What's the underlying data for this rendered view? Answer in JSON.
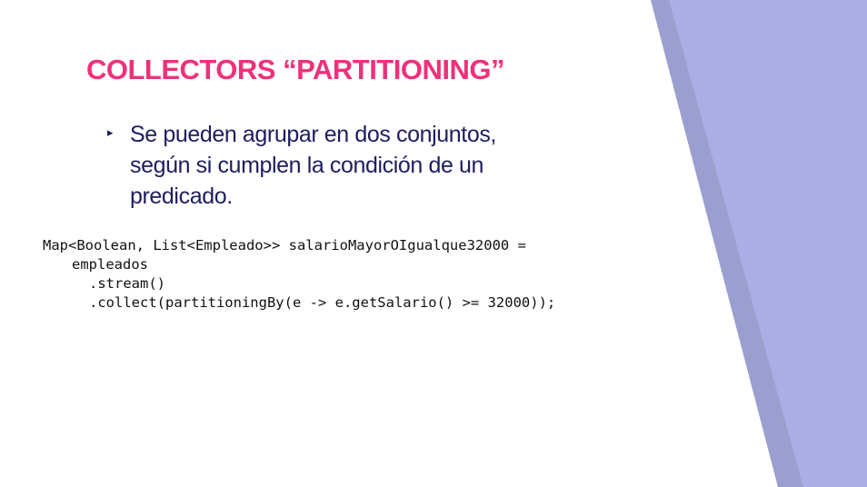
{
  "slide": {
    "title": "COLLECTORS “PARTITIONING”",
    "bullet": {
      "marker": "▸",
      "text": "Se pueden agrupar en dos conjuntos, según si cumplen la condición de un predicado."
    },
    "code_lines": [
      "Map<Boolean, List<Empleado>> salarioMayorOIgualque32000 =",
      "empleados",
      ".stream()",
      ".collect(partitioningBy(e -> e.getSalario() >= 32000));"
    ]
  },
  "colors": {
    "title": "#f0307a",
    "bullet_text": "#1e1d5e",
    "decor_dark": "#9b9fcf",
    "decor_light": "#aaaee4"
  }
}
